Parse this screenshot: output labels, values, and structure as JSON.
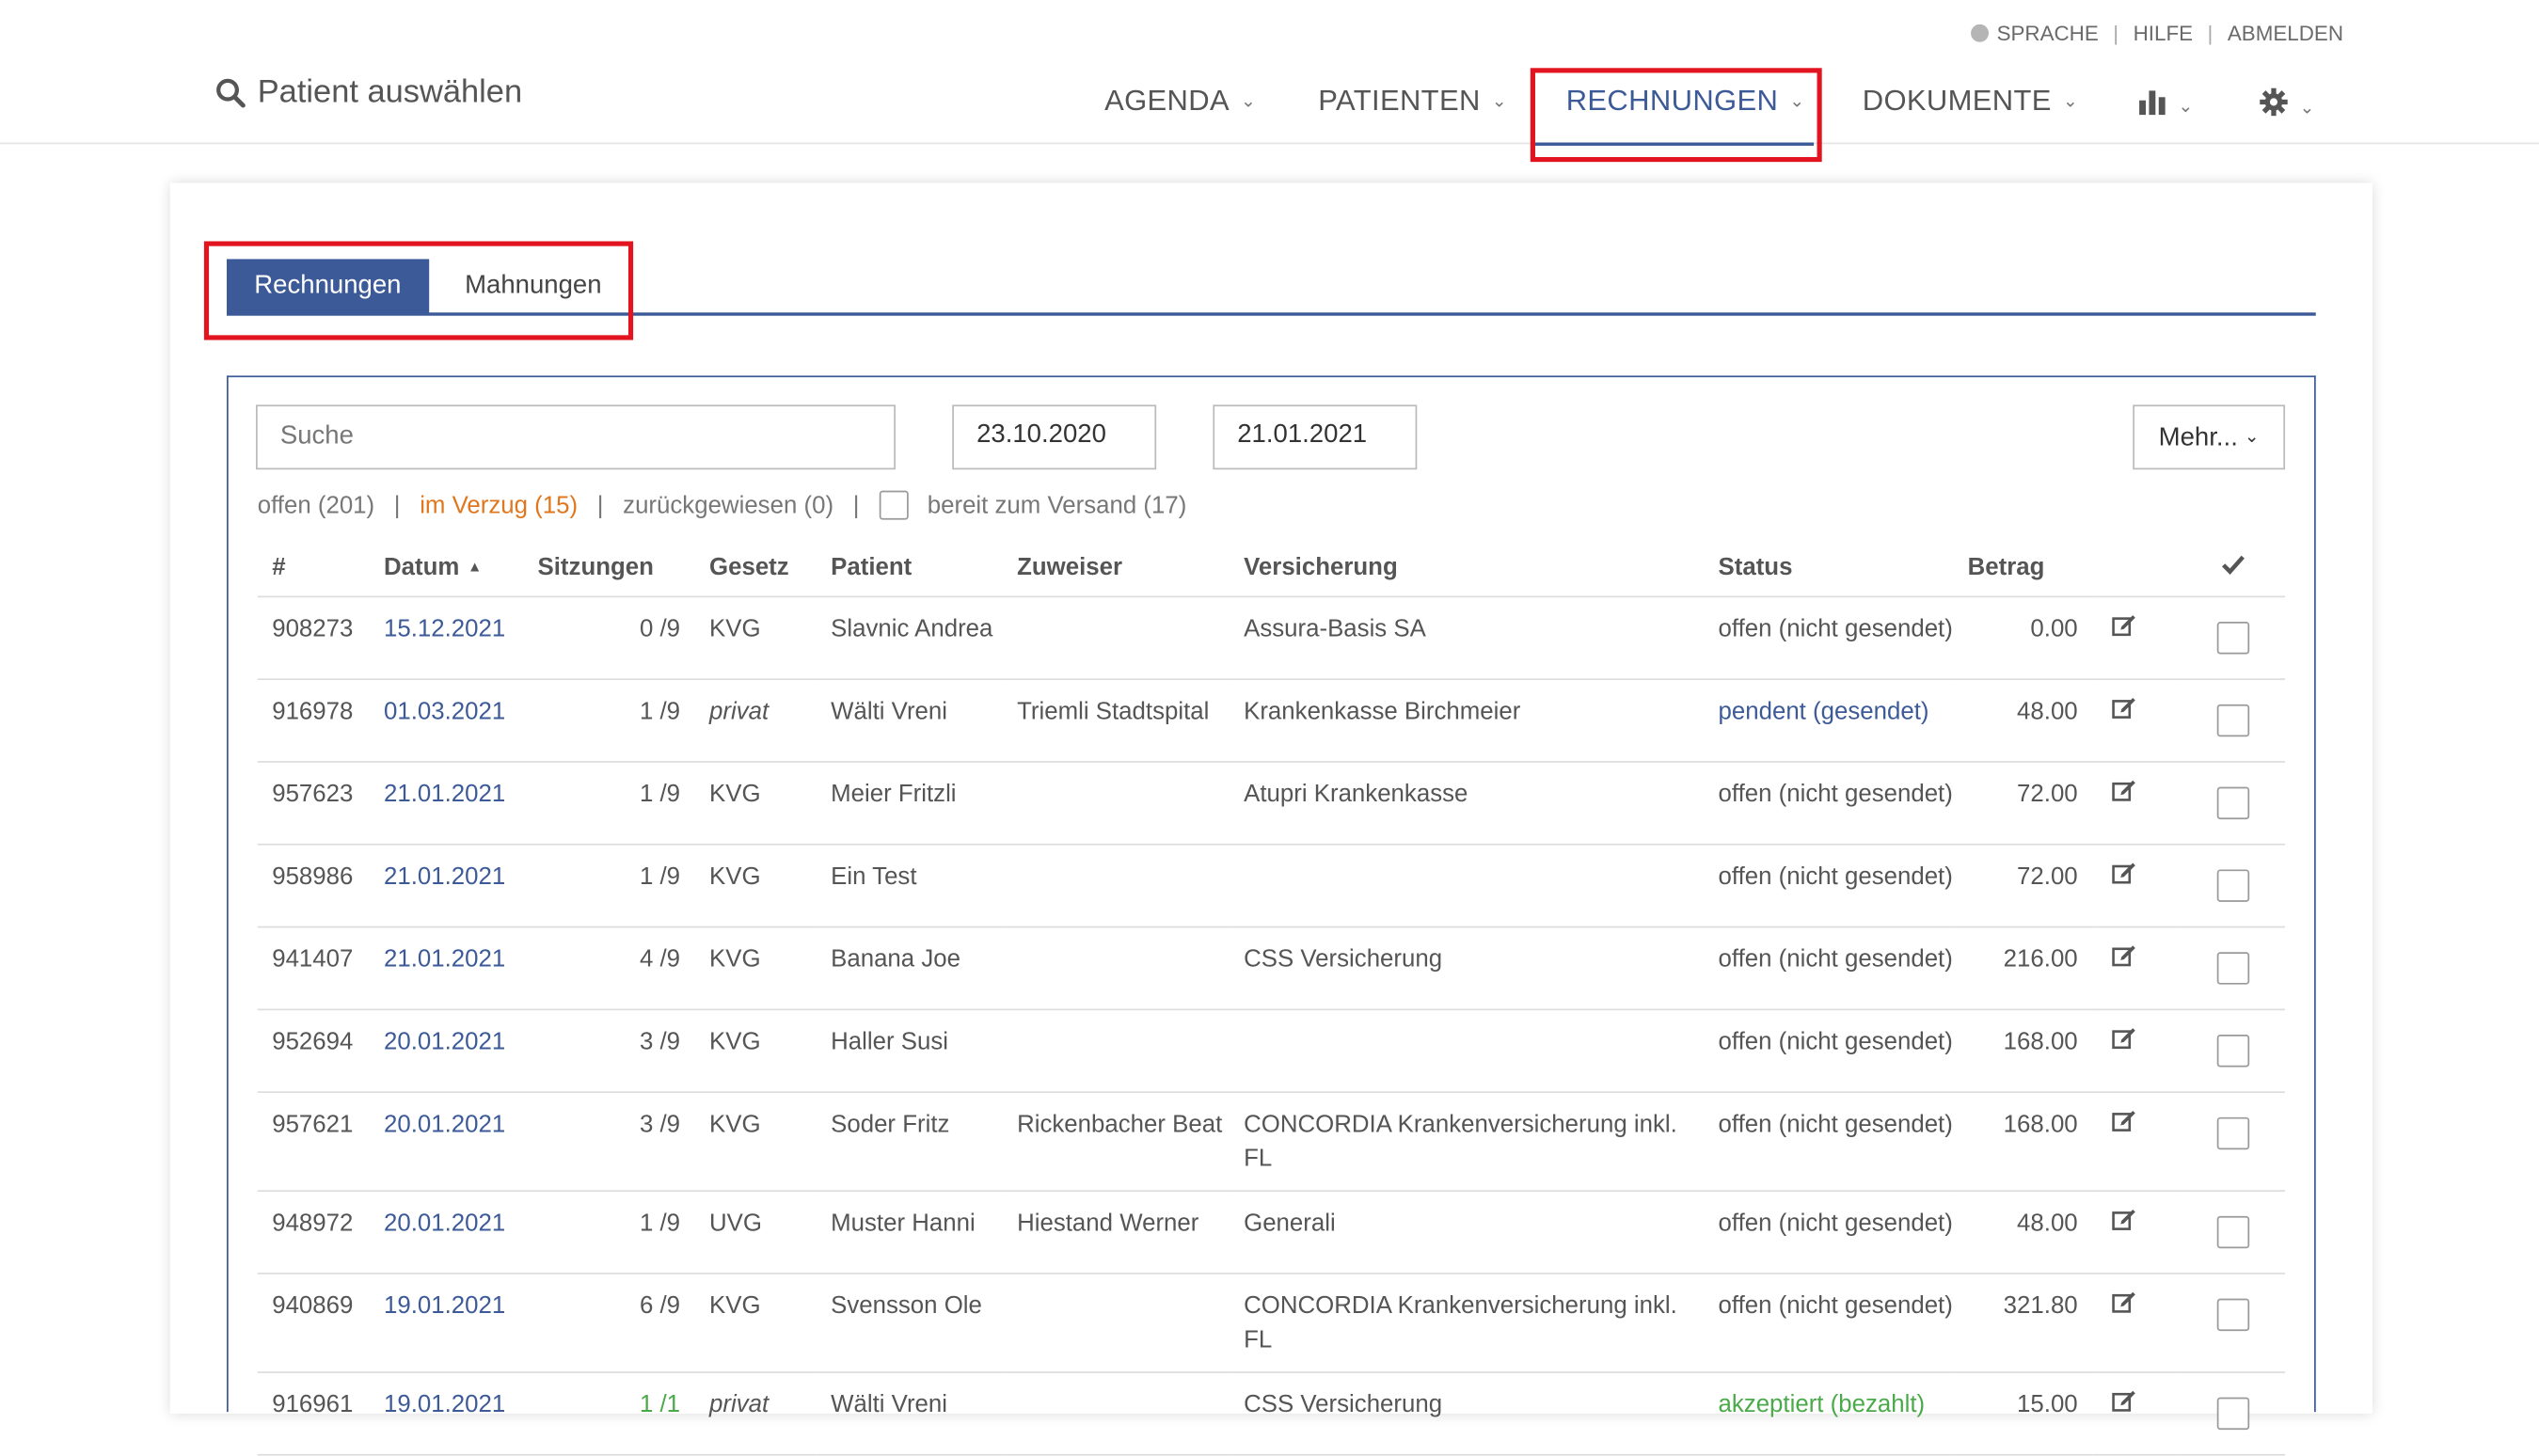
{
  "header": {
    "util": {
      "language": "SPRACHE",
      "help": "HILFE",
      "logout": "ABMELDEN"
    },
    "search_link": "Patient auswählen",
    "nav": [
      {
        "label": "AGENDA"
      },
      {
        "label": "PATIENTEN"
      },
      {
        "label": "RECHNUNGEN"
      },
      {
        "label": "DOKUMENTE"
      }
    ],
    "icons": [
      "bar-chart-icon",
      "gear-icon"
    ]
  },
  "tabs": [
    {
      "label": "Rechnungen"
    },
    {
      "label": "Mahnungen"
    }
  ],
  "filters": {
    "search_placeholder": "Suche",
    "date_from": "23.10.2020",
    "date_to": "21.01.2021",
    "more_button": "Mehr...",
    "open": "offen (201)",
    "overdue": "im Verzug (15)",
    "rejected": "zurückgewiesen (0)",
    "ready": "bereit zum Versand (17)"
  },
  "colors": {
    "accent": "#3d5a98",
    "warning": "#e0771e",
    "success": "#4aaa4a",
    "highlight": "#e2141f"
  },
  "table": {
    "columns": [
      "#",
      "Datum",
      "Sitzungen",
      "Gesetz",
      "Patient",
      "Zuweiser",
      "Versicherung",
      "Status",
      "Betrag"
    ],
    "rows": [
      {
        "id": "908273",
        "date": "15.12.2021",
        "sessions": "0 /9",
        "law": "KVG",
        "patient": "Slavnic Andrea",
        "referrer": "",
        "insurance": "Assura-Basis SA",
        "status": "offen (nicht gesendet)",
        "amount": "0.00"
      },
      {
        "id": "916978",
        "date": "01.03.2021",
        "sessions": "1 /9",
        "law": "privat",
        "patient": "Wälti Vreni",
        "referrer": "Triemli Stadtspital",
        "insurance": "Krankenkasse Birchmeier",
        "status": "pendent (gesendet)",
        "amount": "48.00"
      },
      {
        "id": "957623",
        "date": "21.01.2021",
        "sessions": "1 /9",
        "law": "KVG",
        "patient": "Meier Fritzli",
        "referrer": "",
        "insurance": "Atupri Krankenkasse",
        "status": "offen (nicht gesendet)",
        "amount": "72.00"
      },
      {
        "id": "958986",
        "date": "21.01.2021",
        "sessions": "1 /9",
        "law": "KVG",
        "patient": "Ein Test",
        "referrer": "",
        "insurance": "",
        "status": "offen (nicht gesendet)",
        "amount": "72.00"
      },
      {
        "id": "941407",
        "date": "21.01.2021",
        "sessions": "4 /9",
        "law": "KVG",
        "patient": "Banana Joe",
        "referrer": "",
        "insurance": "CSS Versicherung",
        "status": "offen (nicht gesendet)",
        "amount": "216.00"
      },
      {
        "id": "952694",
        "date": "20.01.2021",
        "sessions": "3 /9",
        "law": "KVG",
        "patient": "Haller Susi",
        "referrer": "",
        "insurance": "",
        "status": "offen (nicht gesendet)",
        "amount": "168.00"
      },
      {
        "id": "957621",
        "date": "20.01.2021",
        "sessions": "3 /9",
        "law": "KVG",
        "patient": "Soder Fritz",
        "referrer": "Rickenbacher Beat",
        "insurance": "CONCORDIA Krankenversicherung inkl. FL",
        "status": "offen (nicht gesendet)",
        "amount": "168.00"
      },
      {
        "id": "948972",
        "date": "20.01.2021",
        "sessions": "1 /9",
        "law": "UVG",
        "patient": "Muster Hanni",
        "referrer": "Hiestand Werner",
        "insurance": "Generali",
        "status": "offen (nicht gesendet)",
        "amount": "48.00"
      },
      {
        "id": "940869",
        "date": "19.01.2021",
        "sessions": "6 /9",
        "law": "KVG",
        "patient": "Svensson Ole",
        "referrer": "",
        "insurance": "CONCORDIA Krankenversicherung inkl. FL",
        "status": "offen (nicht gesendet)",
        "amount": "321.80"
      },
      {
        "id": "916961",
        "date": "19.01.2021",
        "sessions": "1 /1",
        "law": "privat",
        "patient": "Wälti Vreni",
        "referrer": "",
        "insurance": "CSS Versicherung",
        "status": "akzeptiert (bezahlt)",
        "amount": "15.00"
      }
    ]
  }
}
